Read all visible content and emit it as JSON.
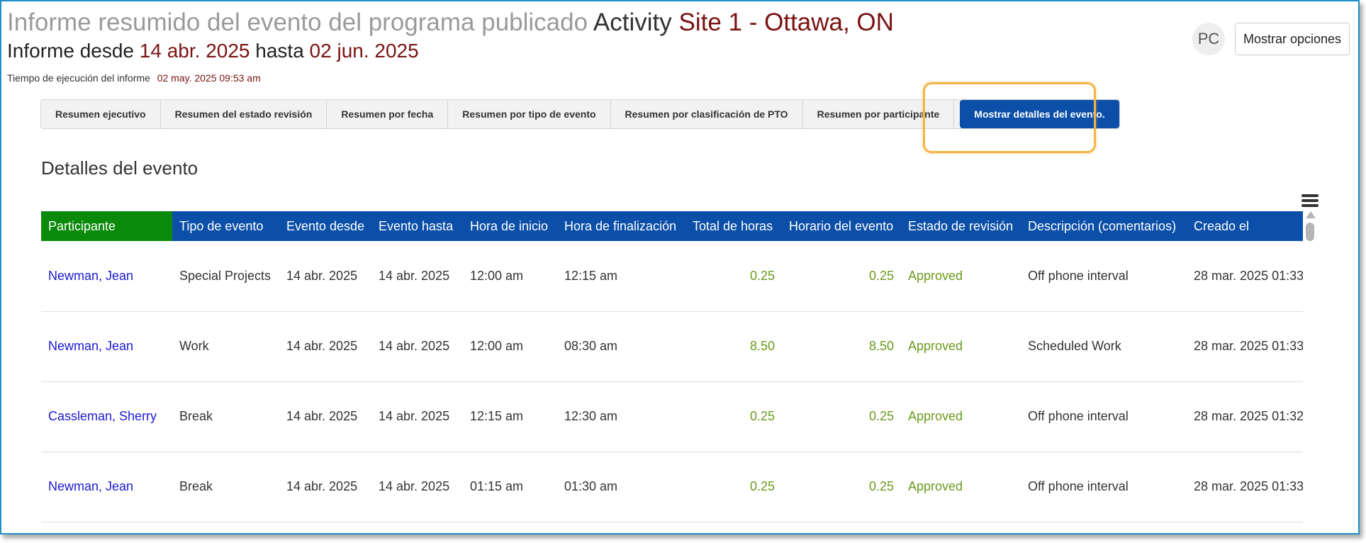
{
  "header": {
    "title_part1": "Informe resumido del evento del programa publicado",
    "title_part2": "Activity",
    "title_part3": "Site 1 - Ottawa, ON",
    "range_prefix": "Informe desde",
    "range_from": "14 abr. 2025",
    "range_mid": "hasta",
    "range_to": "02 jun. 2025",
    "runtime_label": "Tiempo de ejecución del informe",
    "runtime_value": "02 may. 2025 09:53 am"
  },
  "user": {
    "avatar_initials": "PC"
  },
  "toolbar": {
    "options_label": "Mostrar opciones"
  },
  "tabs": [
    {
      "label": "Resumen ejecutivo"
    },
    {
      "label": "Resumen del estado revisión"
    },
    {
      "label": "Resumen por fecha"
    },
    {
      "label": "Resumen por tipo de evento"
    },
    {
      "label": "Resumen por clasificación de PTO"
    },
    {
      "label": "Resumen por participante"
    },
    {
      "label": "Mostrar detalles del evento."
    }
  ],
  "active_tab_index": 6,
  "section": {
    "title": "Detalles del evento"
  },
  "table": {
    "columns": [
      "Participante",
      "Tipo de evento",
      "Evento desde",
      "Evento hasta",
      "Hora de inicio",
      "Hora de finalización",
      "Total de horas",
      "Horario del evento",
      "Estado de revisión",
      "Descripción (comentarios)",
      "Creado el"
    ],
    "rows": [
      [
        "Newman, Jean",
        "Special Projects",
        "14 abr. 2025",
        "14 abr. 2025",
        "12:00 am",
        "12:15 am",
        "0.25",
        "0.25",
        "Approved",
        "Off phone interval",
        "28 mar. 2025 01:33"
      ],
      [
        "Newman, Jean",
        "Work",
        "14 abr. 2025",
        "14 abr. 2025",
        "12:00 am",
        "08:30 am",
        "8.50",
        "8.50",
        "Approved",
        "Scheduled Work",
        "28 mar. 2025 01:33"
      ],
      [
        "Cassleman, Sherry",
        "Break",
        "14 abr. 2025",
        "14 abr. 2025",
        "12:15 am",
        "12:30 am",
        "0.25",
        "0.25",
        "Approved",
        "Off phone interval",
        "28 mar. 2025 01:32"
      ],
      [
        "Newman, Jean",
        "Break",
        "14 abr. 2025",
        "14 abr. 2025",
        "01:15 am",
        "01:30 am",
        "0.25",
        "0.25",
        "Approved",
        "Off phone interval",
        "28 mar. 2025 01:33"
      ]
    ]
  },
  "icons": {
    "menu": "hamburger-menu-icon",
    "scroll_up": "scroll-up-icon"
  },
  "colors": {
    "accent_blue": "#0b4fa8",
    "participant_header_green": "#0a8a0a",
    "approved_green": "#6a9a1c",
    "link_blue": "#1a1ad0",
    "title_red": "#7a1212",
    "highlight_orange": "#f3b447"
  }
}
